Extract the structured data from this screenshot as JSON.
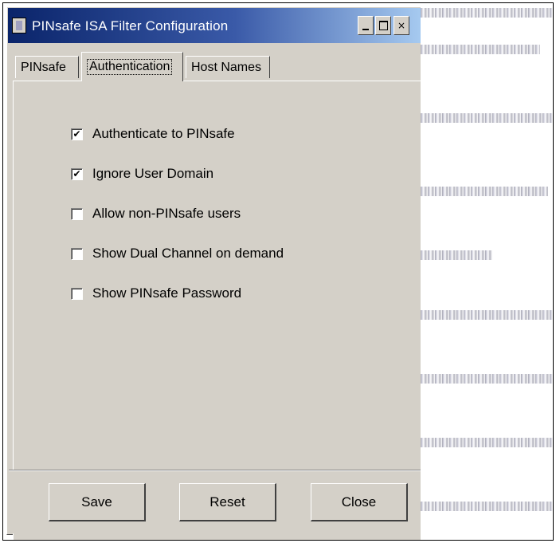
{
  "window": {
    "title": "PINsafe ISA Filter Configuration",
    "controls": {
      "minimize": "_",
      "maximize": "□",
      "close": "×"
    }
  },
  "tabs": [
    {
      "label": "PINsafe",
      "active": false
    },
    {
      "label": "Authentication",
      "active": true
    },
    {
      "label": "Host Names",
      "active": false
    }
  ],
  "options": [
    {
      "label": "Authenticate to PINsafe",
      "checked": true
    },
    {
      "label": "Ignore User Domain",
      "checked": true
    },
    {
      "label": "Allow non-PINsafe users",
      "checked": false
    },
    {
      "label": "Show Dual Channel on demand",
      "checked": false
    },
    {
      "label": "Show PINsafe Password",
      "checked": false
    }
  ],
  "buttons": {
    "save": "Save",
    "reset": "Reset",
    "close": "Close"
  },
  "colors": {
    "dialog_bg": "#d4d0c8",
    "titlebar_start": "#0a246a",
    "titlebar_end": "#a6caf0"
  }
}
